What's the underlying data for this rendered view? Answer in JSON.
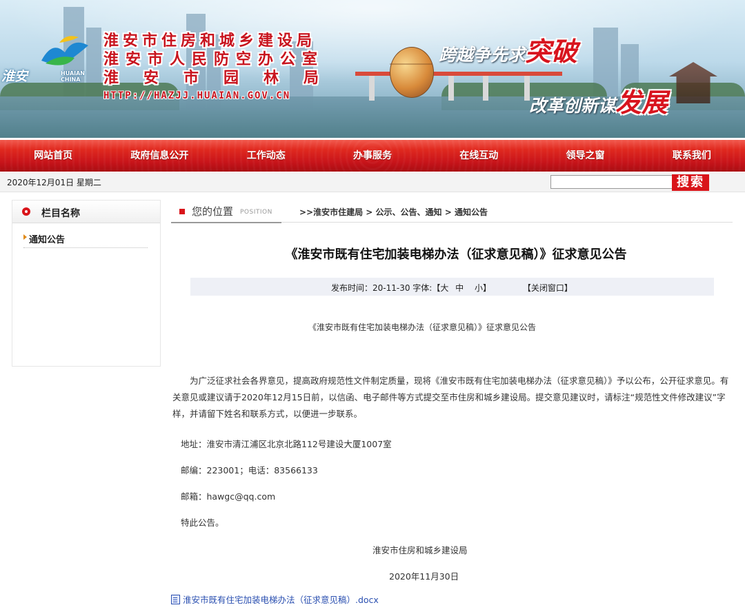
{
  "banner": {
    "org_lines": [
      "淮安市住房和城乡建设局",
      "淮安市人民防空办公室",
      "淮安市园林局"
    ],
    "url": "HTTP://HAZJJ.HUAIAN.GOV.CN",
    "logo_cn": "淮安",
    "logo_en": "HUAIAN CHINA",
    "slogan1": {
      "text": "跨越争先求",
      "highlight": "突破"
    },
    "slogan2": {
      "text": "改革创新谋",
      "highlight": "发展"
    },
    "accent_color": "#c8141e"
  },
  "nav": {
    "items": [
      "网站首页",
      "政府信息公开",
      "工作动态",
      "办事服务",
      "在线互动",
      "领导之窗",
      "联系我们"
    ]
  },
  "datebar": {
    "date": "2020年12月01日 星期二",
    "search_placeholder": "",
    "search_label": "搜索"
  },
  "sidebar": {
    "title": "栏目名称",
    "items": [
      "通知公告"
    ]
  },
  "location": {
    "label": "您的位置",
    "label_en": "POSITION",
    "prefix": ">>",
    "crumbs": [
      "淮安市住建局",
      "公示、公告、通知",
      "通知公告"
    ],
    "separator": " > "
  },
  "article": {
    "title": "《淮安市既有住宅加装电梯办法（征求意见稿）》征求意见公告",
    "meta": {
      "published": "发布时间：20-11-30 字体:【大",
      "font_medium": "中",
      "font_small": "小】",
      "close": "【关闭窗口】"
    },
    "subhead": "《淮安市既有住宅加装电梯办法（征求意见稿）》征求意见公告",
    "body": "为广泛征求社会各界意见，提高政府规范性文件制定质量，现将《淮安市既有住宅加装电梯办法（征求意见稿）》予以公布，公开征求意见。有关意见或建议请于2020年12月15日前，以信函、电子邮件等方式提交至市住房和城乡建设局。提交意见建议时，请标注“规范性文件修改建议”字样，并请留下姓名和联系方式，以便进一步联系。",
    "address": "地址：淮安市清江浦区北京北路112号建设大厦1007室",
    "postcode": "邮编：223001；电话：83566133",
    "email": "邮箱：hawgc@qq.com",
    "closing": "特此公告。",
    "signature": "淮安市住房和城乡建设局",
    "sign_date": "2020年11月30日",
    "attachment": "淮安市既有住宅加装电梯办法（征求意见稿）.docx"
  }
}
